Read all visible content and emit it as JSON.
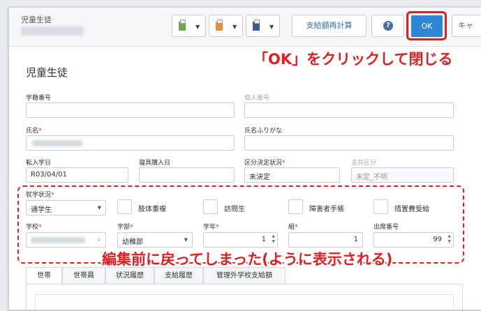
{
  "window": {
    "title": "児童生徒"
  },
  "toolbar": {
    "recalc_label": "支給額再計算",
    "help_icon": "?",
    "ok_label": "OK",
    "cancel_label": "キャ",
    "clip_colors": [
      "#6aa84f",
      "#e69138",
      "#3d5a96"
    ],
    "dropdown_glyph": "▼"
  },
  "annotations": {
    "ok_instruction": "「OK」をクリックして閉じる",
    "reverted_note": "編集前に戻ってしまった(ように表示される)"
  },
  "form": {
    "section_title": "児童生徒",
    "required_mark": "*",
    "student_no": {
      "label": "学籍番号",
      "value": ""
    },
    "personal_no": {
      "label": "個人番号",
      "value": ""
    },
    "name": {
      "label": "氏名"
    },
    "name_kana": {
      "label": "氏名ふりがな",
      "value": ""
    },
    "transfer_date": {
      "label": "転入学日",
      "value": "R03/04/01"
    },
    "purchase_date": {
      "label": "寝具購入日",
      "value": ""
    },
    "category_status": {
      "label": "区分決定状況",
      "value": "未決定"
    },
    "payment_category": {
      "label": "支弁区分",
      "value": "未定_不明"
    },
    "enrollment": {
      "label": "就学状況",
      "value": "通学生"
    },
    "checkboxes": [
      {
        "label": "肢体重複"
      },
      {
        "label": "訪問生"
      },
      {
        "label": "障害者手帳"
      },
      {
        "label": "措置費受給"
      }
    ],
    "school": {
      "label": "学校"
    },
    "department": {
      "label": "学部",
      "value": "幼稚部"
    },
    "grade": {
      "label": "学年",
      "value": "1"
    },
    "class": {
      "label": "組",
      "value": "1"
    },
    "seat_no": {
      "label": "出席番号",
      "value": "99"
    }
  },
  "tabs": [
    "世帯",
    "世帯員",
    "状況履歴",
    "支給履歴",
    "管理外学校支給額"
  ],
  "colors": {
    "accent": "#2e86d7",
    "annotation": "#e41e1e"
  }
}
